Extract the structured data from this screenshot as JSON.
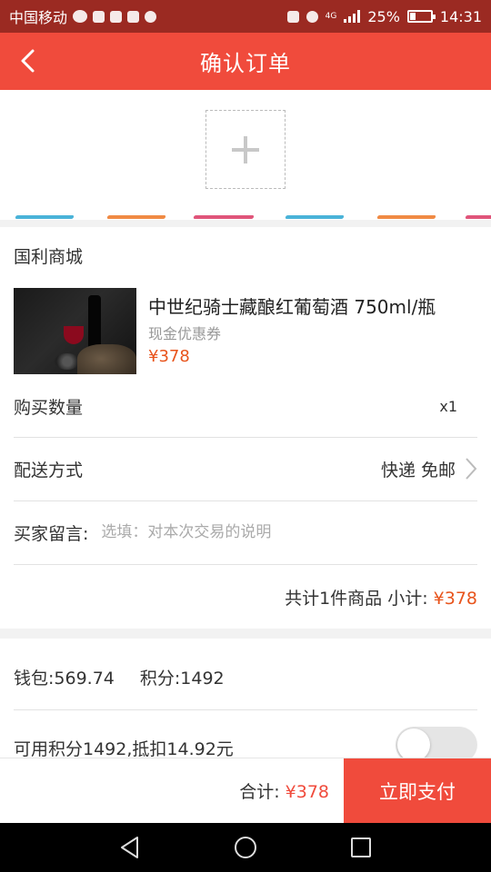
{
  "status_bar": {
    "carrier": "中国移动",
    "network": "4G",
    "battery": "25%",
    "time": "14:31"
  },
  "header": {
    "title": "确认订单",
    "back_icon": "chevron-left-icon"
  },
  "address": {
    "add_icon": "plus-icon"
  },
  "order": {
    "store": "国利商城",
    "product": {
      "name": "中世纪骑士藏酿红葡萄酒 750ml/瓶",
      "coupon": "现金优惠券",
      "price": "¥378"
    },
    "quantity_label": "购买数量",
    "quantity_value": "x1",
    "shipping_label": "配送方式",
    "shipping_value": "快递 免邮",
    "note_label": "买家留言:",
    "note_placeholder": "选填：对本次交易的说明",
    "subtotal_prefix": "共计1件商品 小计: ",
    "subtotal_amount": "¥378"
  },
  "wallet": {
    "balance": "钱包:569.74",
    "points": "积分:1492",
    "points_deduct": "可用积分1492,抵扣14.92元",
    "toggle_on": false
  },
  "pay_bar": {
    "total_prefix": "合计: ",
    "total_amount": "¥378",
    "pay_label": "立即支付"
  },
  "colors": {
    "brand_red": "#f04b3c",
    "status_bar": "#9b2a22",
    "price_orange": "#e8541c"
  }
}
